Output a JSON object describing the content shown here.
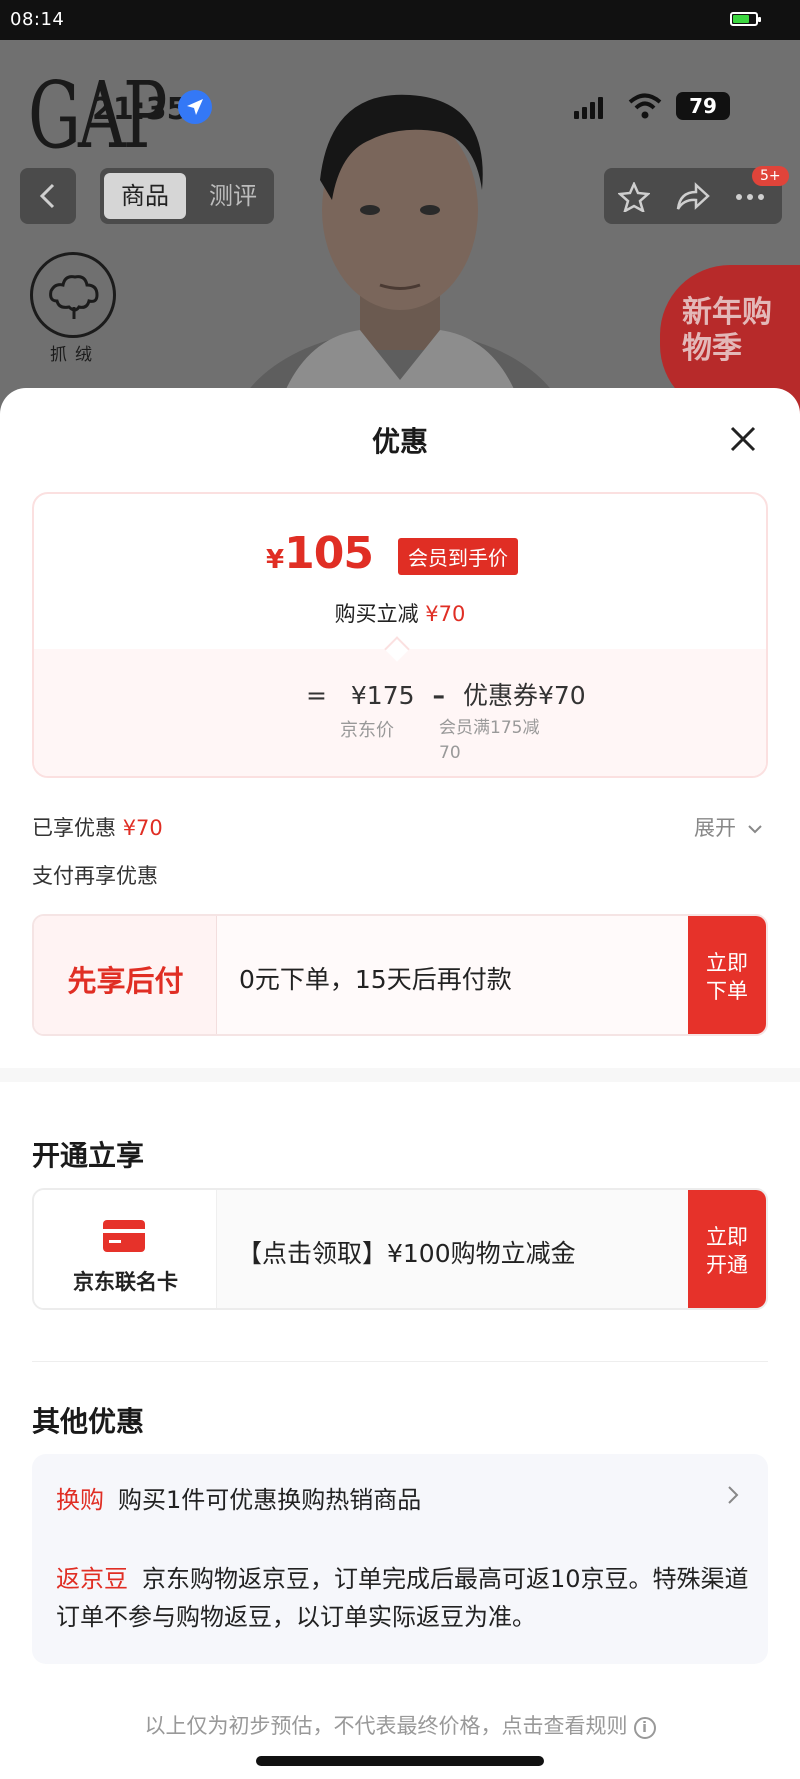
{
  "status_bar": {
    "time": "08:14"
  },
  "product_page": {
    "brand_logo": "GAP",
    "inner_status": {
      "time": "21:35",
      "battery": "79"
    },
    "tabs": [
      "商品",
      "测评"
    ],
    "cart_badge": "5+",
    "feature_label": "抓绒",
    "promo_banner": "新年购物季"
  },
  "sheet": {
    "title": "优惠",
    "price_card": {
      "yen": "¥",
      "final_price": "105",
      "member_tag": "会员到手价",
      "cut_text": "购买立减",
      "cut_amount": "¥70",
      "formula": {
        "eq": "=",
        "jd_price": "¥175",
        "minus": "–",
        "coupon": "优惠券¥70"
      },
      "jd_price_label": "京东价",
      "coupon_desc": "会员满175减70"
    },
    "enjoyed": {
      "label": "已享优惠",
      "amount": "¥70",
      "expand": "展开"
    },
    "pay_more_label": "支付再享优惠",
    "bnpl": {
      "name": "先享后付",
      "desc": "0元下单，15天后再付款",
      "button": "立即下单"
    },
    "open_section": {
      "title": "开通立享",
      "card_name": "京东联名卡",
      "desc": "【点击领取】¥100购物立减金",
      "button": "立即开通"
    },
    "other_section": {
      "title": "其他优惠",
      "exchange": {
        "tag": "换购",
        "text": "购买1件可优惠换购热销商品"
      },
      "jingdou": {
        "tag": "返京豆",
        "text": "京东购物返京豆，订单完成后最高可返10京豆。特殊渠道订单不参与购物返豆，以订单实际返豆为准。"
      }
    },
    "footnote": "以上仅为初步预估，不代表最终价格，点击查看规则"
  },
  "colors": {
    "accent": "#e02e24",
    "button": "#e6322a",
    "location": "#3478f6"
  }
}
